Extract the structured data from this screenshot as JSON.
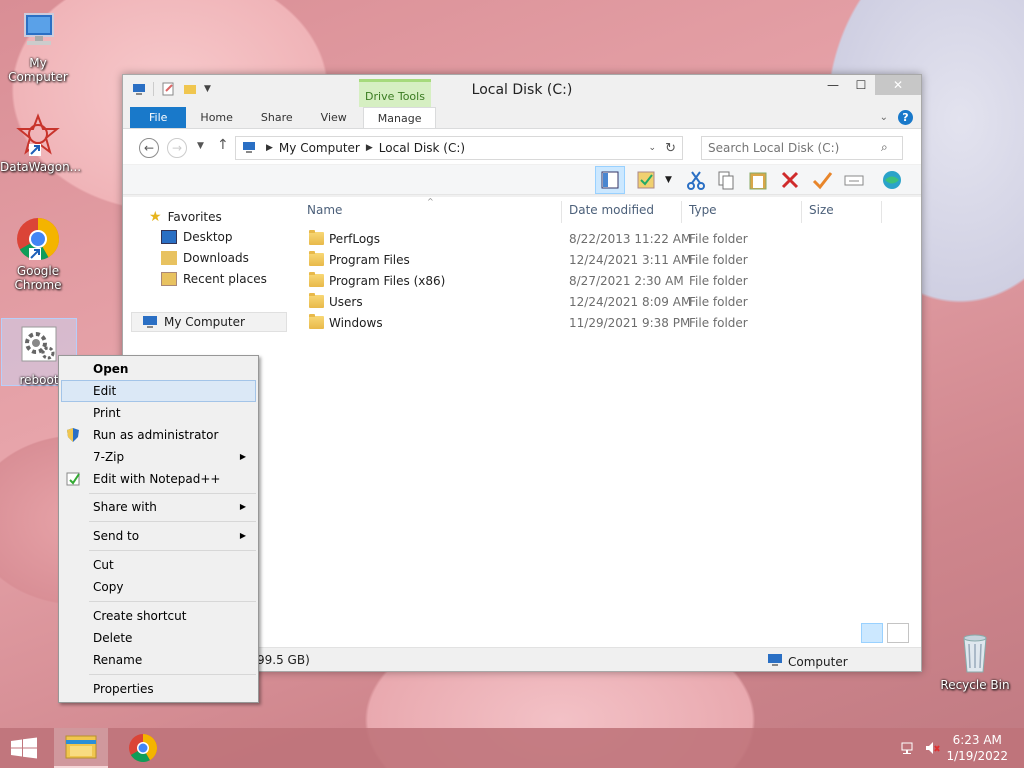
{
  "desktop": {
    "icons": [
      {
        "label": "My Computer"
      },
      {
        "label": "DataWagon..."
      },
      {
        "label": "Google Chrome"
      },
      {
        "label": "reboot"
      },
      {
        "label": "Recycle Bin"
      }
    ]
  },
  "window": {
    "title": "Local Disk (C:)",
    "contextual_tab_group": "Drive Tools",
    "tabs": [
      "File",
      "Home",
      "Share",
      "View",
      "Manage"
    ],
    "address": {
      "path": [
        "My Computer",
        "Local Disk (C:)"
      ]
    },
    "search": {
      "placeholder": "Search Local Disk (C:)"
    },
    "nav": {
      "favorites": "Favorites",
      "desktop": "Desktop",
      "downloads": "Downloads",
      "recent": "Recent places",
      "computer": "My Computer"
    },
    "columns": {
      "name": "Name",
      "date": "Date modified",
      "type": "Type",
      "size": "Size"
    },
    "files": [
      {
        "name": "PerfLogs",
        "date": "8/22/2013 11:22 AM",
        "type": "File folder"
      },
      {
        "name": "Program Files",
        "date": "12/24/2021 3:11 AM",
        "type": "File folder"
      },
      {
        "name": "Program Files (x86)",
        "date": "8/27/2021 2:30 AM",
        "type": "File folder"
      },
      {
        "name": "Users",
        "date": "12/24/2021 8:09 AM",
        "type": "File folder"
      },
      {
        "name": "Windows",
        "date": "11/29/2021 9:38 PM",
        "type": "File folder"
      }
    ],
    "status": {
      "left": "99.5 GB)",
      "right": "Computer"
    }
  },
  "context_menu": {
    "open": "Open",
    "edit": "Edit",
    "print": "Print",
    "run_as_admin": "Run as administrator",
    "zip": "7-Zip",
    "notepadpp": "Edit with Notepad++",
    "share_with": "Share with",
    "send_to": "Send to",
    "cut": "Cut",
    "copy": "Copy",
    "create_shortcut": "Create shortcut",
    "delete": "Delete",
    "rename": "Rename",
    "properties": "Properties"
  },
  "taskbar": {
    "time": "6:23 AM",
    "date": "1/19/2022"
  },
  "colors": {
    "accent": "#1979ca",
    "drive_tools": "#d6efc2",
    "menu_hover": "#dbe8f6"
  }
}
